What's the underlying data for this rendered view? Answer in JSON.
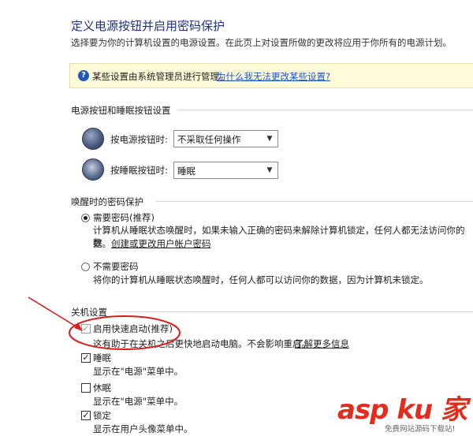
{
  "header": {
    "title": "定义电源按钮并启用密码保护",
    "description": "选择要为你的计算机设置的电源设置。在此页上对设置所做的更改将应用于你所有的电源计划。"
  },
  "info_bar": {
    "icon": "question-shield-icon",
    "text": "某些设置由系统管理员进行管理。",
    "link": "为什么我无法更改某些设置?"
  },
  "power_buttons": {
    "section_title": "电源按钮和睡眠按钮设置",
    "power_label": "按电源按钮时:",
    "power_value": "不采取任何操作",
    "sleep_label": "按睡眠按钮时:",
    "sleep_value": "睡眠"
  },
  "wake_password": {
    "section_title": "唤醒时的密码保护",
    "require_label": "需要密码(推荐)",
    "require_desc": "计算机从睡眠状态唤醒时，如果未输入正确的密码来解除计算机锁定，任何人都无法访问你的数",
    "require_desc2": "据。",
    "require_link": "创建或更改用户帐户密码",
    "no_require_label": "不需要密码",
    "no_require_desc": "将你的计算机从睡眠状态唤醒时，任何人都可以访问你的数据，因为计算机未锁定。",
    "selected": "require"
  },
  "shutdown": {
    "section_title": "关机设置",
    "fast_startup_label": "启用快速启动(推荐)",
    "fast_startup_desc": "这有助于在关机之后更快地启动电脑。不会影响重启。",
    "fast_startup_link": "了解更多信息",
    "fast_startup_checked": true,
    "sleep_label": "睡眠",
    "sleep_desc": "显示在\"电源\"菜单中。",
    "sleep_checked": true,
    "hibernate_label": "休眠",
    "hibernate_desc": "显示在\"电源\"菜单中。",
    "hibernate_checked": false,
    "lock_label": "锁定",
    "lock_desc": "显示在用户头像菜单中。",
    "lock_checked": true
  },
  "watermark": {
    "logo": "asp ku 家",
    "sub": "免费网站源码下载站!"
  },
  "colors": {
    "title_blue": "#1e3287",
    "link_blue": "#1d53c8",
    "annotation_red": "#d81e1e",
    "info_bg": "#fdfbd8"
  }
}
